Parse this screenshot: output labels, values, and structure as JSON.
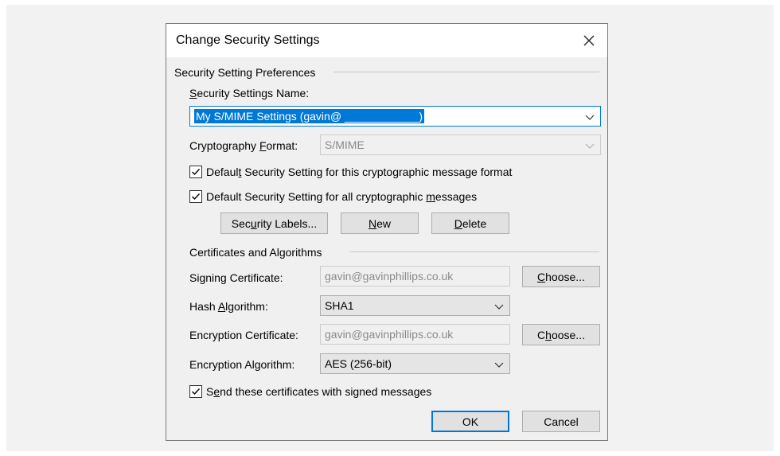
{
  "dialog": {
    "title": "Change Security Settings",
    "close_glyph": "✕"
  },
  "preferences": {
    "group_title": "Security Setting Preferences",
    "name_label": "Security Settings Name:",
    "name_value": "My S/MIME Settings (gavin@ ____________)",
    "format_label": "Cryptography Format:",
    "format_value": "S/MIME",
    "default_format_checkbox": {
      "label": "Default Security Setting for this cryptographic message format",
      "checked": true
    },
    "default_all_checkbox": {
      "label": "Default Security Setting for all cryptographic messages",
      "checked": true
    },
    "buttons": {
      "security_labels": "Security Labels...",
      "new": "New",
      "delete": "Delete"
    }
  },
  "certificates": {
    "group_title": "Certificates and Algorithms",
    "signing_cert_label": "Signing Certificate:",
    "signing_cert_value": "gavin@gavinphillips.co.uk",
    "hash_label": "Hash Algorithm:",
    "hash_value": "SHA1",
    "encryption_cert_label": "Encryption Certificate:",
    "encryption_cert_value": "gavin@gavinphillips.co.uk",
    "encryption_alg_label": "Encryption Algorithm:",
    "encryption_alg_value": "AES (256-bit)",
    "choose_label": "Choose...",
    "send_certs_checkbox": {
      "label": "Send these certificates with signed messages",
      "checked": true
    }
  },
  "footer": {
    "ok": "OK",
    "cancel": "Cancel"
  },
  "colors": {
    "accent": "#0078d7",
    "dialog_bg": "#f0f0f0",
    "button_bg": "#e1e1e1"
  },
  "icons": {
    "close": "close-icon",
    "dropdown": "chevron-down-icon",
    "checkmark": "checkmark-icon"
  }
}
